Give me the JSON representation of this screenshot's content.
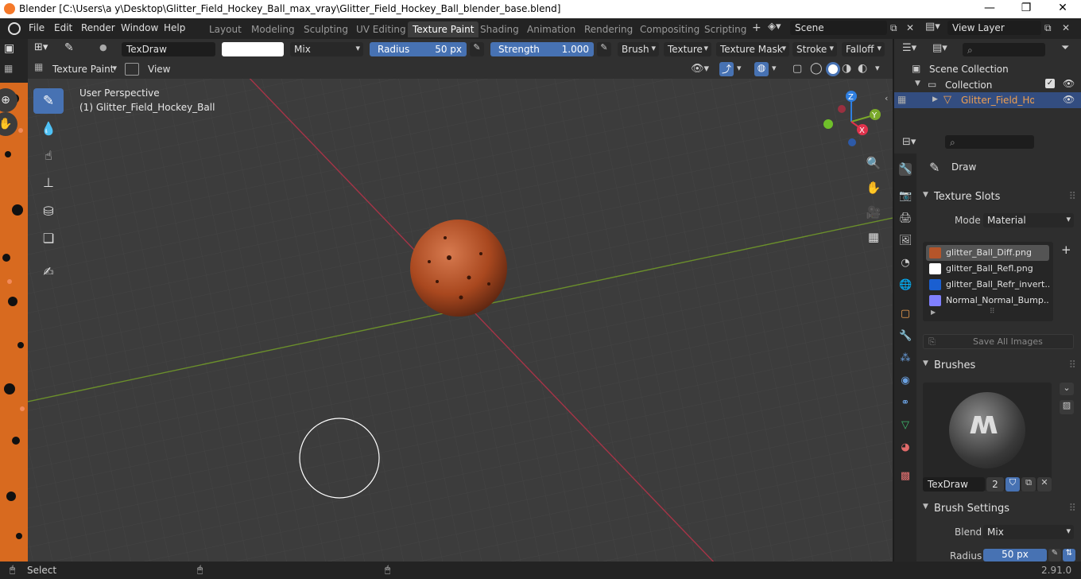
{
  "window": {
    "title": "Blender [C:\\Users\\a y\\Desktop\\Glitter_Field_Hockey_Ball_max_vray\\Glitter_Field_Hockey_Ball_blender_base.blend]"
  },
  "menu": [
    "File",
    "Edit",
    "Render",
    "Window",
    "Help"
  ],
  "workspaces": [
    "Layout",
    "Modeling",
    "Sculpting",
    "UV Editing",
    "Texture Paint",
    "Shading",
    "Animation",
    "Rendering",
    "Compositing",
    "Scripting"
  ],
  "active_workspace": "Texture Paint",
  "scene": {
    "name": "Scene"
  },
  "view_layer": {
    "name": "View Layer"
  },
  "toolbar": {
    "brush_name": "TexDraw",
    "blend": "Mix",
    "radius_label": "Radius",
    "radius_value": "50 px",
    "strength_label": "Strength",
    "strength_value": "1.000",
    "strength_fraction": 1.0,
    "dropdowns": [
      "Brush",
      "Texture",
      "Texture Mask",
      "Stroke",
      "Falloff"
    ]
  },
  "header2": {
    "mode": "Texture Paint",
    "view": "View"
  },
  "viewport": {
    "perspective": "User Perspective",
    "object": "(1) Glitter_Field_Hockey_Ball",
    "gizmo": {
      "z": "Z",
      "y": "Y",
      "x": "X"
    }
  },
  "outliner": {
    "scene_collection": "Scene Collection",
    "collection": "Collection",
    "object": "Glitter_Field_Hockey_Ball"
  },
  "properties": {
    "active_tool": "Draw",
    "texture_slots": {
      "header": "Texture Slots",
      "mode_label": "Mode",
      "mode_value": "Material",
      "slots": [
        {
          "name": "glitter_Ball_Diff.png",
          "color": "#b5552a"
        },
        {
          "name": "glitter_Ball_Refl.png",
          "color": "#ffffff"
        },
        {
          "name": "glitter_Ball_Refr_invert....",
          "color": "#1a5fd1"
        },
        {
          "name": "Normal_Normal_Bump....",
          "color": "#8080ff"
        }
      ],
      "save_all": "Save All Images"
    },
    "brushes": {
      "header": "Brushes",
      "brush_name": "TexDraw",
      "users": "2"
    },
    "brush_settings": {
      "header": "Brush Settings",
      "blend_label": "Blend",
      "blend_value": "Mix",
      "radius_label": "Radius",
      "radius_value": "50 px"
    }
  },
  "status": {
    "select": "Select",
    "version": "2.91.0"
  },
  "colors": {
    "accent": "#4772b3",
    "highlight": "#334d80",
    "x_axis": "#e0324c",
    "y_axis": "#7aa82a",
    "z_axis": "#2f7fe0",
    "ball": "#b5552a"
  }
}
